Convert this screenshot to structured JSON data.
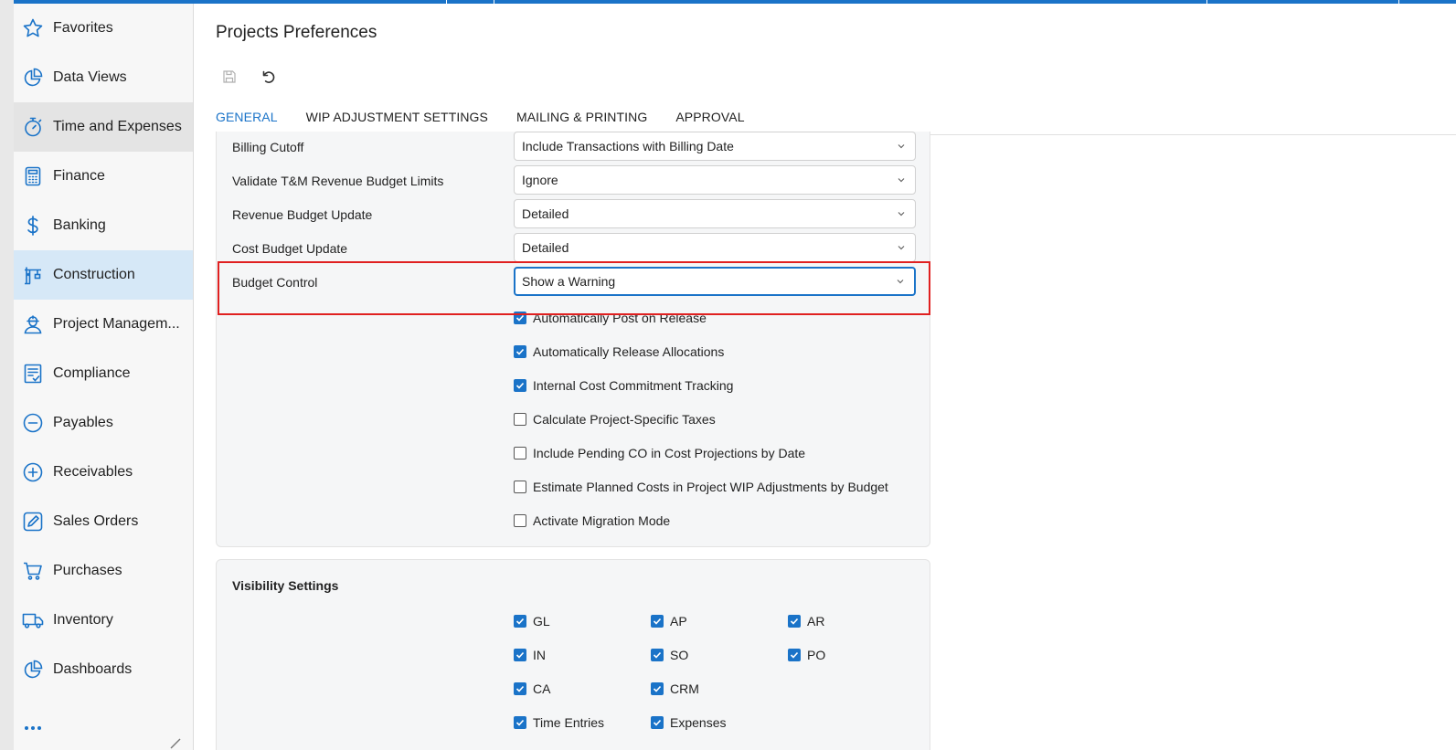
{
  "sidebar": {
    "items": [
      {
        "label": "Favorites",
        "icon": "star-icon"
      },
      {
        "label": "Data Views",
        "icon": "pie-chart-icon"
      },
      {
        "label": "Time and Expenses",
        "icon": "stopwatch-icon"
      },
      {
        "label": "Finance",
        "icon": "calculator-icon"
      },
      {
        "label": "Banking",
        "icon": "dollar-icon"
      },
      {
        "label": "Construction",
        "icon": "crane-icon"
      },
      {
        "label": "Project Managem...",
        "icon": "worker-icon"
      },
      {
        "label": "Compliance",
        "icon": "checklist-icon"
      },
      {
        "label": "Payables",
        "icon": "minus-circle-icon"
      },
      {
        "label": "Receivables",
        "icon": "plus-circle-icon"
      },
      {
        "label": "Sales Orders",
        "icon": "pencil-square-icon"
      },
      {
        "label": "Purchases",
        "icon": "cart-icon"
      },
      {
        "label": "Inventory",
        "icon": "truck-icon"
      },
      {
        "label": "Dashboards",
        "icon": "dashboard-pie-icon"
      }
    ]
  },
  "page": {
    "title": "Projects Preferences"
  },
  "tabs": [
    "GENERAL",
    "WIP ADJUSTMENT SETTINGS",
    "MAILING & PRINTING",
    "APPROVAL"
  ],
  "general": {
    "fields": [
      {
        "label": "Billing Cutoff",
        "value": "Include Transactions with Billing Date"
      },
      {
        "label": "Validate T&M Revenue Budget Limits",
        "value": "Ignore"
      },
      {
        "label": "Revenue Budget Update",
        "value": "Detailed"
      },
      {
        "label": "Cost Budget Update",
        "value": "Detailed"
      },
      {
        "label": "Budget Control",
        "value": "Show a Warning"
      }
    ],
    "checkboxes": [
      {
        "label": "Automatically Post on Release",
        "checked": true
      },
      {
        "label": "Automatically Release Allocations",
        "checked": true
      },
      {
        "label": "Internal Cost Commitment Tracking",
        "checked": true
      },
      {
        "label": "Calculate Project-Specific Taxes",
        "checked": false
      },
      {
        "label": "Include Pending CO in Cost Projections by Date",
        "checked": false
      },
      {
        "label": "Estimate Planned Costs in Project WIP Adjustments by Budget",
        "checked": false
      },
      {
        "label": "Activate Migration Mode",
        "checked": false
      }
    ]
  },
  "visibility": {
    "title": "Visibility Settings",
    "items": [
      {
        "label": "GL",
        "checked": true
      },
      {
        "label": "AP",
        "checked": true
      },
      {
        "label": "AR",
        "checked": true
      },
      {
        "label": "IN",
        "checked": true
      },
      {
        "label": "SO",
        "checked": true
      },
      {
        "label": "PO",
        "checked": true
      },
      {
        "label": "CA",
        "checked": true
      },
      {
        "label": "CRM",
        "checked": true
      },
      {
        "label": "Time Entries",
        "checked": true
      },
      {
        "label": "Expenses",
        "checked": true
      }
    ]
  },
  "colors": {
    "accent": "#1a73c8",
    "highlight": "#e02020",
    "active_nav_bg": "#d6e8f7"
  }
}
